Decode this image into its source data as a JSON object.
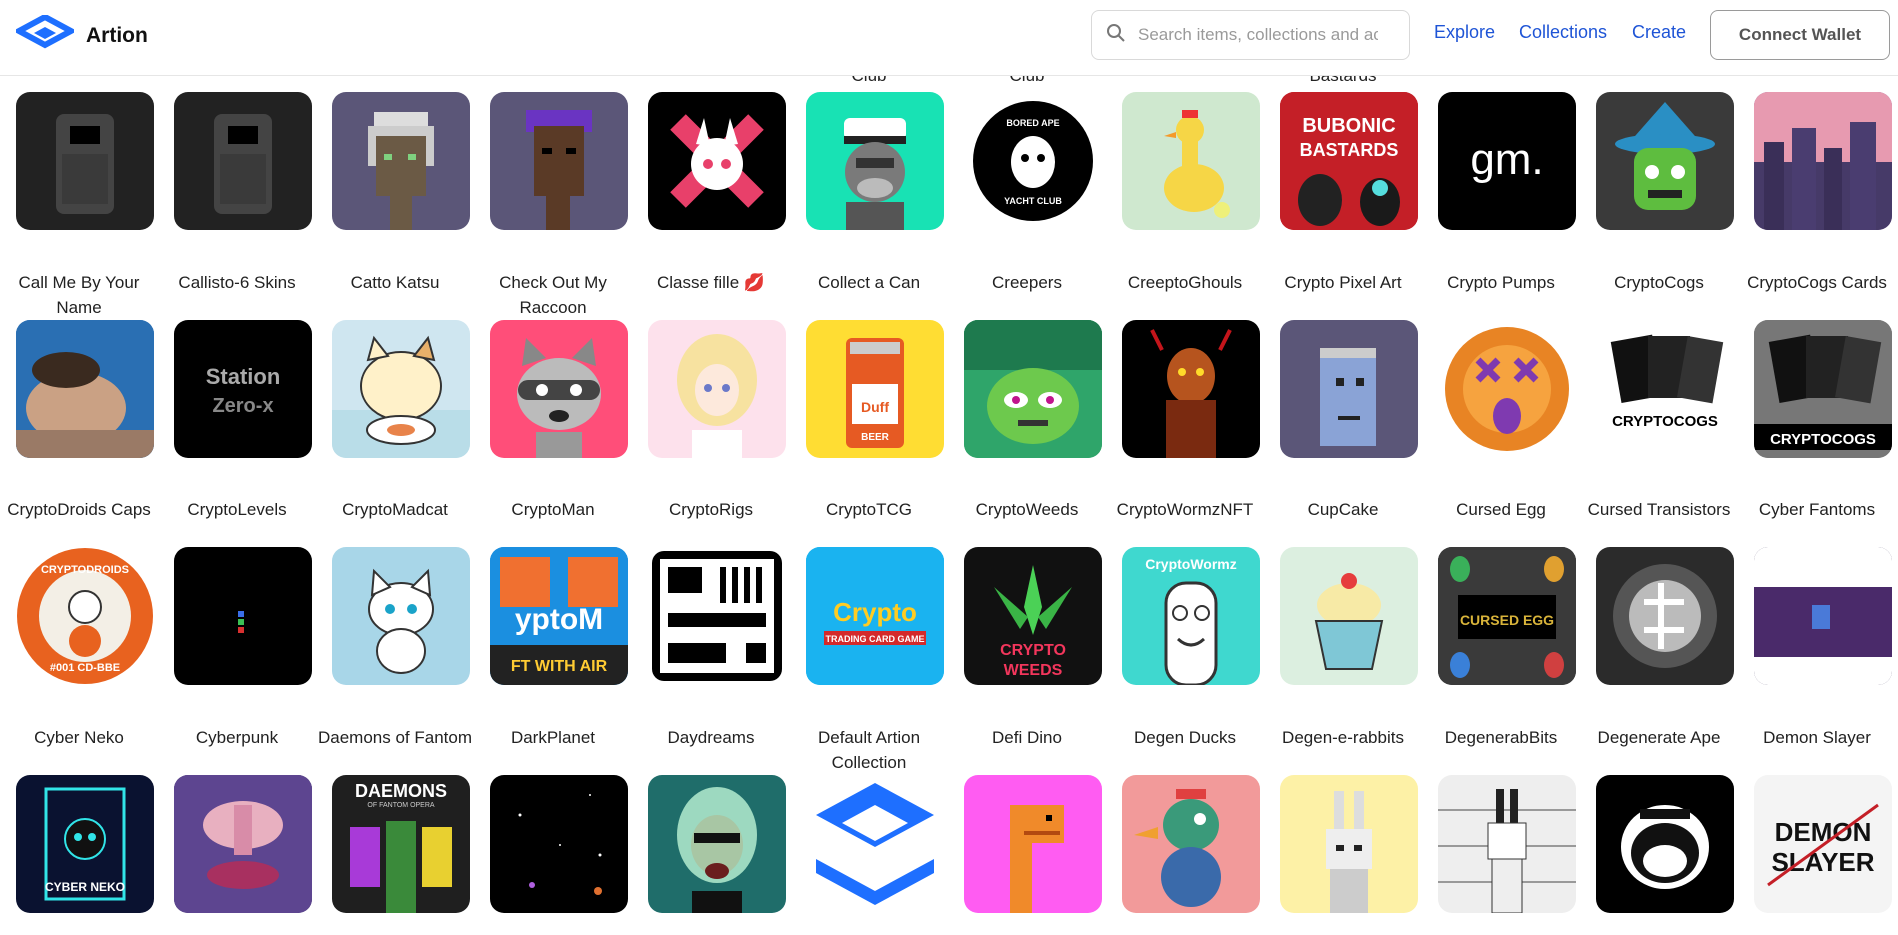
{
  "header": {
    "brand": "Artion",
    "search_placeholder": "Search items, collections and accounts",
    "nav": {
      "explore": "Explore",
      "collections": "Collections",
      "create": "Create"
    },
    "connect_wallet": "Connect Wallet"
  },
  "colors": {
    "brand_blue": "#1e6fff",
    "nav_link": "#1e54d6"
  },
  "rows": [
    {
      "items": [
        {
          "name": "",
          "bg": "#222222",
          "art": "bot"
        },
        {
          "name": "",
          "bg": "#222222",
          "art": "bot"
        },
        {
          "name": "",
          "bg": "#5b5678",
          "art": "pixel-face-grey"
        },
        {
          "name": "",
          "bg": "#5b5678",
          "art": "pixel-face-brown"
        },
        {
          "name": "",
          "bg": "#000000",
          "art": "pink-x"
        },
        {
          "name": "Club",
          "bg": "#18e2b4",
          "art": "captain-ape"
        },
        {
          "name": "Club",
          "bg": "#ffffff",
          "art": "bayc-logo"
        },
        {
          "name": "",
          "bg": "#cfe8cf",
          "art": "duck"
        },
        {
          "name": "Bastards",
          "bg": "#c41f27",
          "art": "bubonic"
        },
        {
          "name": "",
          "bg": "#000000",
          "art": "gm-text"
        },
        {
          "name": "",
          "bg": "#3a3a3a",
          "art": "zombie-wizard"
        },
        {
          "name": "",
          "bg": "#8a5f9e",
          "art": "city"
        }
      ]
    },
    {
      "items": [
        {
          "name": "Call Me By Your Name",
          "bg": "#2a6fb3",
          "art": "photo"
        },
        {
          "name": "Callisto-6 Skins",
          "bg": "#000000",
          "art": "station-zero"
        },
        {
          "name": "Catto Katsu",
          "bg": "#cfe6f0",
          "art": "cat-katsu"
        },
        {
          "name": "Check Out My Raccoon",
          "bg": "#ff4e79",
          "art": "raccoon"
        },
        {
          "name": "Classe fille 💋",
          "bg": "#fde1ec",
          "art": "anime-girl"
        },
        {
          "name": "Collect a Can",
          "bg": "#ffdd33",
          "art": "can"
        },
        {
          "name": "Creepers",
          "bg": "#2fa56a",
          "art": "creepers"
        },
        {
          "name": "CreeptoGhouls",
          "bg": "#000000",
          "art": "ghoul"
        },
        {
          "name": "Crypto Pixel Art",
          "bg": "#5b5678",
          "art": "pixel-head-blue"
        },
        {
          "name": "Crypto Pumps",
          "bg": "#ffffff",
          "art": "pump-egg"
        },
        {
          "name": "CryptoCogs",
          "bg": "#ffffff",
          "art": "cogs-cards"
        },
        {
          "name": "CryptoCogs Cards",
          "bg": "#888888",
          "art": "cogs-cards-dark"
        }
      ]
    },
    {
      "items": [
        {
          "name": "CryptoDroids Caps",
          "bg": "#ffffff",
          "art": "droid-cap"
        },
        {
          "name": "CryptoLevels",
          "bg": "#000000",
          "art": "tiny-block"
        },
        {
          "name": "CryptoMadcat",
          "bg": "#a8d6e8",
          "art": "white-cat"
        },
        {
          "name": "CryptoMan",
          "bg": "#1b8fe0",
          "art": "cryptoman"
        },
        {
          "name": "CryptoRigs",
          "bg": "#ffffff",
          "art": "rigs"
        },
        {
          "name": "CryptoTCG",
          "bg": "#1ab3f0",
          "art": "tcg"
        },
        {
          "name": "CryptoWeeds",
          "bg": "#111111",
          "art": "weed"
        },
        {
          "name": "CryptoWormzNFT",
          "bg": "#3fd8cf",
          "art": "worm"
        },
        {
          "name": "CupCake",
          "bg": "#dcefe0",
          "art": "cupcake"
        },
        {
          "name": "Cursed Egg",
          "bg": "#333333",
          "art": "cursed-egg"
        },
        {
          "name": "Cursed Transistors",
          "bg": "#2b2b2b",
          "art": "transistor"
        },
        {
          "name": "Cyber Fantoms",
          "bg": "#2a1f4a",
          "art": "fantoms"
        }
      ]
    },
    {
      "items": [
        {
          "name": "Cyber Neko",
          "bg": "#0a1230",
          "art": "neko"
        },
        {
          "name": "Cyberpunk",
          "bg": "#3a2a5e",
          "art": "lips"
        },
        {
          "name": "Daemons of Fantom",
          "bg": "#1f1f1f",
          "art": "daemons"
        },
        {
          "name": "DarkPlanet",
          "bg": "#000000",
          "art": "space"
        },
        {
          "name": "Daydreams",
          "bg": "#1f6d6a",
          "art": "daydreams"
        },
        {
          "name": "Default Artion Collection",
          "bg": "#ffffff",
          "art": "artion-logo"
        },
        {
          "name": "Defi Dino",
          "bg": "#ff5cf2",
          "art": "dino"
        },
        {
          "name": "Degen Ducks",
          "bg": "#f29a9a",
          "art": "degen-duck"
        },
        {
          "name": "Degen-e-rabbits",
          "bg": "#fdf1a6",
          "art": "rabbit"
        },
        {
          "name": "DegenerabBits",
          "bg": "#eeeeee",
          "art": "rabbit-lineup"
        },
        {
          "name": "Degenerate Ape",
          "bg": "#000000",
          "art": "ape-mono"
        },
        {
          "name": "Demon Slayer",
          "bg": "#f4f4f4",
          "art": "demon-slayer"
        }
      ]
    }
  ],
  "tile_text": {
    "bubonic": "BUBONIC BASTARDS",
    "gm": "gm.",
    "bayc_top": "BORED APE",
    "bayc_bottom": "YACHT CLUB",
    "station": "Station Zero-x",
    "cogs": "CRYPTOCOGS",
    "droid": "CRYPTODROIDS",
    "droid_id": "#001 CD-BBE",
    "tcg": "Crypto",
    "tcg_sub": "TRADING CARD GAME",
    "weeds": "CRYPTO WEEDS",
    "wormz": "CryptoWormz",
    "cursed": "CURSED EGG",
    "neko": "CYBER NEKO",
    "daemons": "DAEMONS",
    "daemons_sub": "OF FANTOM OPERA",
    "demon": "DEMON SLAYER",
    "beer": "BEER"
  }
}
